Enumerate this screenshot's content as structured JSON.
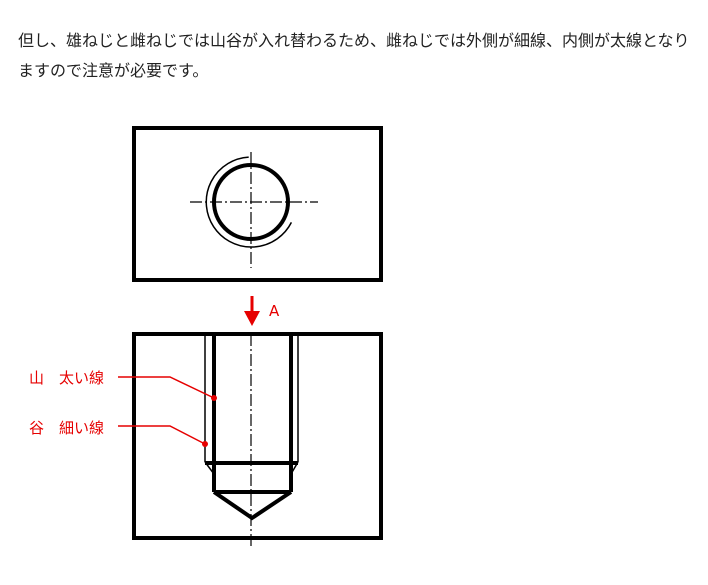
{
  "paragraph": "但し、雄ねじと雌ねじでは山谷が入れ替わるため、雌ねじでは外側が細線、内側が太線となりますので注意が必要です。",
  "diagram": {
    "arrow_label": "A",
    "label_mountain": "山　太い線",
    "label_valley": "谷　細い線",
    "colors": {
      "line": "#000000",
      "annotation": "#e60000",
      "text": "#222222"
    }
  }
}
